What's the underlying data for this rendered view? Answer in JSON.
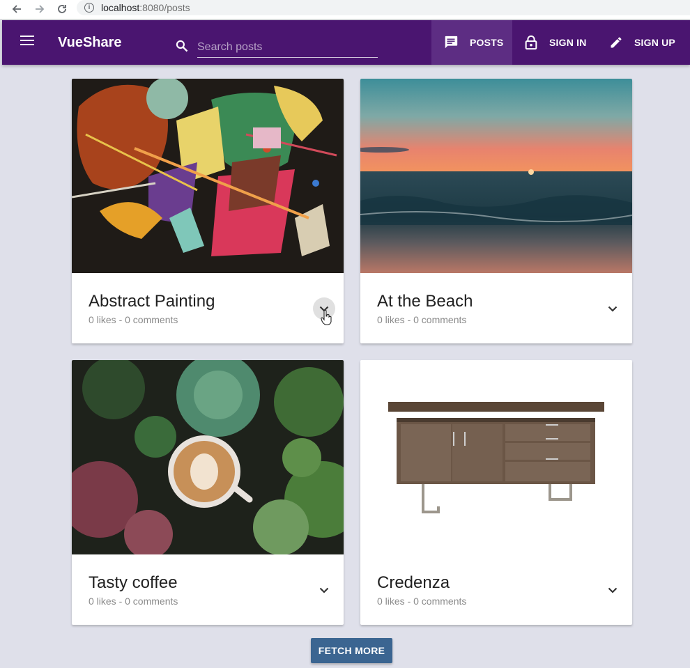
{
  "browser": {
    "url_host": "localhost",
    "url_port": ":8080",
    "url_path": "/posts",
    "icons": [
      "back-arrow-icon",
      "forward-arrow-icon",
      "reload-icon",
      "info-icon"
    ]
  },
  "appbar": {
    "brand": "VueShare",
    "search_placeholder": "Search posts",
    "nav": [
      {
        "label": "POSTS",
        "icon": "message-icon",
        "active": true
      },
      {
        "label": "SIGN IN",
        "icon": "lock-icon",
        "active": false
      },
      {
        "label": "SIGN UP",
        "icon": "pencil-icon",
        "active": false
      }
    ],
    "colors": {
      "bar": "#4a1570",
      "active": "#5d2d83"
    }
  },
  "posts": [
    {
      "title": "Abstract Painting",
      "meta": "0 likes - 0 comments",
      "image": "abstract-painting"
    },
    {
      "title": "At the Beach",
      "meta": "0 likes - 0 comments",
      "image": "beach-sunset"
    },
    {
      "title": "Tasty coffee",
      "meta": "0 likes - 0 comments",
      "image": "coffee-succulents"
    },
    {
      "title": "Credenza",
      "meta": "0 likes - 0 comments",
      "image": "wooden-credenza"
    }
  ],
  "fetch_more_label": "FETCH MORE",
  "colors": {
    "page_bg": "#dfe0ea",
    "button": "#3b6591"
  }
}
